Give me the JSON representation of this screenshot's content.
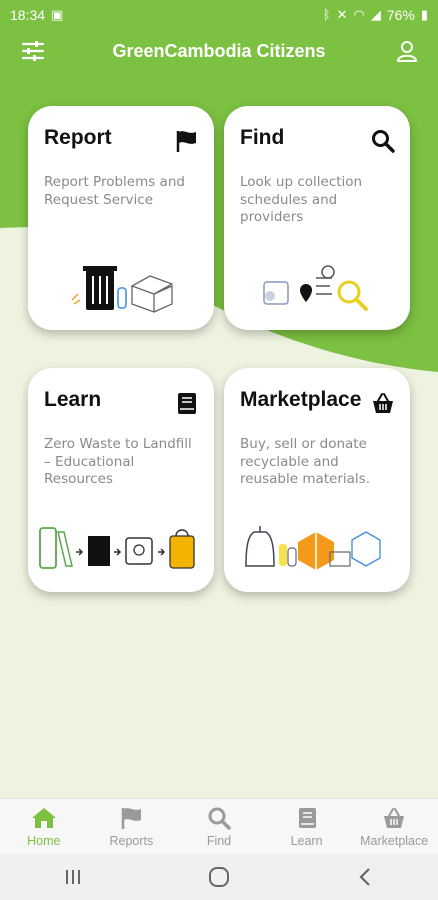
{
  "status": {
    "time": "18:34",
    "battery": "76%"
  },
  "header": {
    "title": "GreenCambodia Citizens"
  },
  "cards": [
    {
      "title": "Report",
      "description": "Report Problems and Request Service",
      "icon": "flag-icon"
    },
    {
      "title": "Find",
      "description": "Look up collection schedules and providers",
      "icon": "search-icon"
    },
    {
      "title": "Learn",
      "description": "Zero Waste to Landfill – Educational Resources",
      "icon": "book-icon"
    },
    {
      "title": "Marketplace",
      "description": "Buy, sell or donate recyclable and reusable materials.",
      "icon": "basket-icon"
    }
  ],
  "bottom_nav": [
    {
      "label": "Home",
      "icon": "home-icon",
      "active": true
    },
    {
      "label": "Reports",
      "icon": "flag-icon",
      "active": false
    },
    {
      "label": "Find",
      "icon": "search-icon",
      "active": false
    },
    {
      "label": "Learn",
      "icon": "book-icon",
      "active": false
    },
    {
      "label": "Marketplace",
      "icon": "basket-icon",
      "active": false
    }
  ],
  "colors": {
    "brand_green": "#7cc142",
    "background_light": "#eef3e0",
    "inactive": "#9a9a9a"
  }
}
